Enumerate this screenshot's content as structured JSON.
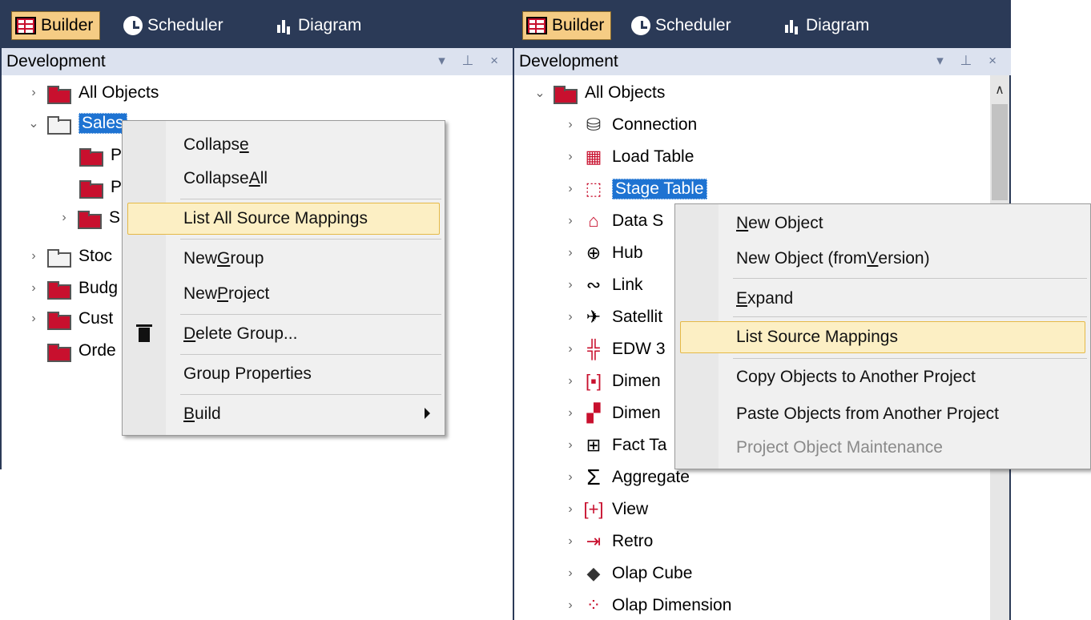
{
  "tabs": [
    {
      "label": "Builder",
      "icon": "builder-icon"
    },
    {
      "label": "Scheduler",
      "icon": "clock-icon"
    },
    {
      "label": "Diagram",
      "icon": "diagram-icon"
    }
  ],
  "left": {
    "header": "Development",
    "tree": [
      {
        "label": "All Objects"
      },
      {
        "label": "Sales"
      },
      {
        "label": "P"
      },
      {
        "label": "P"
      },
      {
        "label": "S"
      },
      {
        "label": "Stoc"
      },
      {
        "label": "Budg"
      },
      {
        "label": "Cust"
      },
      {
        "label": "Orde"
      }
    ],
    "menu": {
      "collapse_pre": "Collaps",
      "collapse_u": "e",
      "collapse_all_pre": "Collapse ",
      "collapse_all_u": "A",
      "collapse_all_post": "ll",
      "list_all": "List All Source Mappings",
      "new_group_pre": "New ",
      "new_group_u": "G",
      "new_group_post": "roup",
      "new_project_pre": "New ",
      "new_project_u": "P",
      "new_project_post": "roject",
      "delete_u": "D",
      "delete_post": "elete Group...",
      "group_props": "Group Properties",
      "build_u": "B",
      "build_post": "uild"
    }
  },
  "right": {
    "header": "Development",
    "root": "All Objects",
    "tree": [
      {
        "label": "Connection"
      },
      {
        "label": "Load Table"
      },
      {
        "label": "Stage Table"
      },
      {
        "label": "Data S"
      },
      {
        "label": "Hub"
      },
      {
        "label": "Link"
      },
      {
        "label": "Satellit"
      },
      {
        "label": "EDW 3"
      },
      {
        "label": "Dimen"
      },
      {
        "label": "Dimen"
      },
      {
        "label": "Fact Ta"
      },
      {
        "label": "Aggregate"
      },
      {
        "label": "View"
      },
      {
        "label": "Retro"
      },
      {
        "label": "Olap Cube"
      },
      {
        "label": "Olap Dimension"
      }
    ],
    "menu": {
      "new_object_u": "N",
      "new_object_post": "ew Object",
      "new_from_version_pre": "New Object (from ",
      "new_from_version_u": "V",
      "new_from_version_post": "ersion)",
      "expand_u": "E",
      "expand_post": "xpand",
      "list_source": "List Source Mappings",
      "copy_objects": "Copy Objects to Another Project",
      "paste_objects": "Paste Objects from Another Project",
      "maintenance": "Project Object Maintenance"
    }
  }
}
